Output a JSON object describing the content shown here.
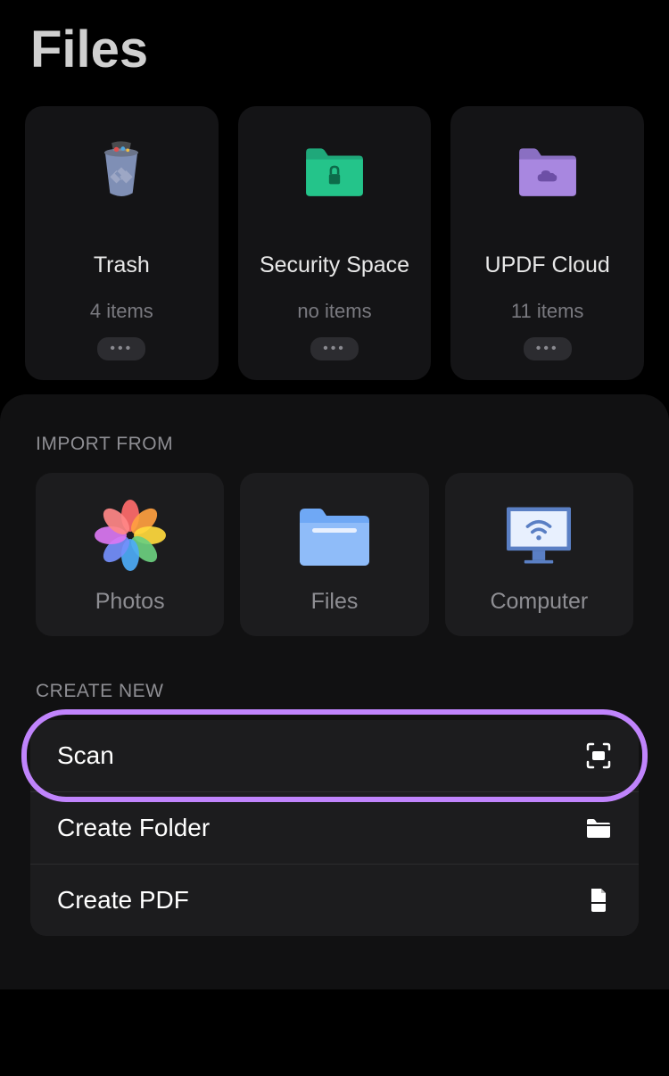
{
  "title": "Files",
  "folders": [
    {
      "label": "Trash",
      "count": "4 items"
    },
    {
      "label": "Security Space",
      "count": "no items"
    },
    {
      "label": "UPDF Cloud",
      "count": "11 items"
    }
  ],
  "import": {
    "header": "IMPORT FROM",
    "items": [
      {
        "label": "Photos"
      },
      {
        "label": "Files"
      },
      {
        "label": "Computer"
      }
    ]
  },
  "create": {
    "header": "CREATE NEW",
    "items": [
      {
        "label": "Scan"
      },
      {
        "label": "Create Folder"
      },
      {
        "label": "Create PDF"
      }
    ]
  }
}
